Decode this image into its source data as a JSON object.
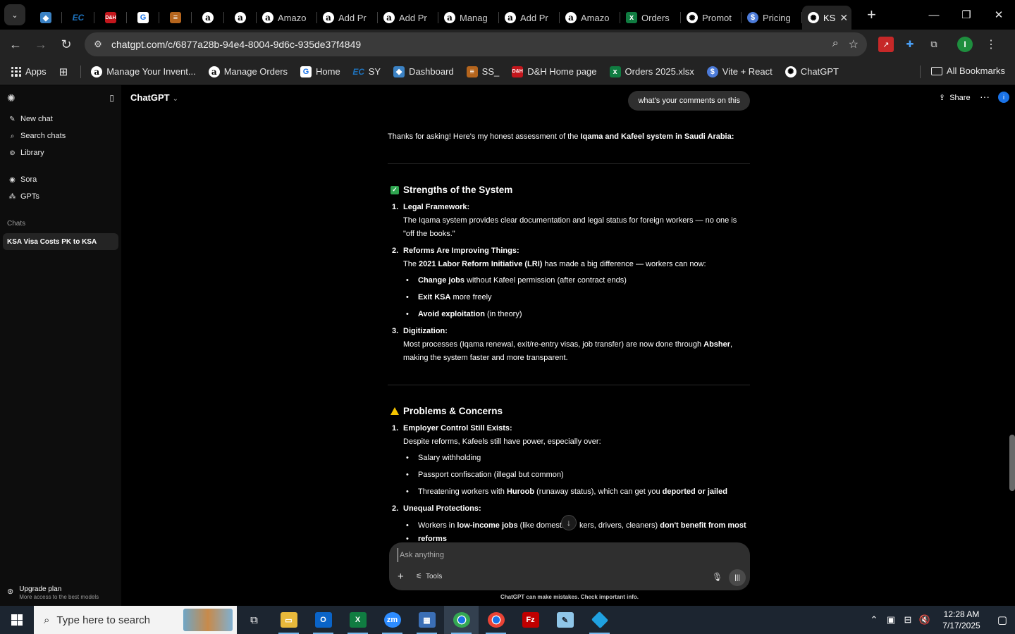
{
  "browser": {
    "tabs": [
      {
        "label": "",
        "icon": "blue-diamond-icon",
        "fav": "fv-blue",
        "glyph": "◆"
      },
      {
        "label": "",
        "icon": "ec-icon",
        "fav": "fv-ec",
        "glyph": "EC"
      },
      {
        "label": "",
        "icon": "dh-icon",
        "fav": "fv-dh",
        "glyph": "D&H"
      },
      {
        "label": "",
        "icon": "google-icon",
        "fav": "fv-g",
        "glyph": "G"
      },
      {
        "label": "",
        "icon": "stack-icon",
        "fav": "fv-stack",
        "glyph": "≡"
      },
      {
        "label": "",
        "icon": "amazon-icon",
        "fav": "fv-amz",
        "glyph": "a"
      },
      {
        "label": "",
        "icon": "amazon-icon",
        "fav": "fv-amz",
        "glyph": "a"
      },
      {
        "label": "Amazo",
        "icon": "amazon-icon",
        "fav": "fv-amz",
        "glyph": "a"
      },
      {
        "label": "Add Pr",
        "icon": "amazon-icon",
        "fav": "fv-amz",
        "glyph": "a"
      },
      {
        "label": "Add Pr",
        "icon": "amazon-icon",
        "fav": "fv-amz",
        "glyph": "a"
      },
      {
        "label": "Manag",
        "icon": "amazon-icon",
        "fav": "fv-amz",
        "glyph": "a"
      },
      {
        "label": "Add Pr",
        "icon": "amazon-icon",
        "fav": "fv-amz",
        "glyph": "a"
      },
      {
        "label": "Amazo",
        "icon": "amazon-icon",
        "fav": "fv-amz",
        "glyph": "a"
      },
      {
        "label": "Orders",
        "icon": "excel-icon",
        "fav": "fv-xl",
        "glyph": "x"
      },
      {
        "label": "Promot",
        "icon": "chatgpt-icon",
        "fav": "fv-gpt",
        "glyph": "✺"
      },
      {
        "label": "Pricing",
        "icon": "dollar-icon",
        "fav": "fv-s",
        "glyph": "$"
      }
    ],
    "active_tab": {
      "label": "KS",
      "icon": "chatgpt-icon"
    },
    "url": "chatgpt.com/c/6877a28b-94e4-8004-9d6c-935de37f4849",
    "bookmarks": [
      {
        "label": "Apps",
        "icon": "apps-grid-icon"
      },
      {
        "label": "Manage Your Invent...",
        "icon": "amazon-icon",
        "fav": "fv-amz",
        "glyph": "a"
      },
      {
        "label": "Manage Orders",
        "icon": "amazon-icon",
        "fav": "fv-amz",
        "glyph": "a"
      },
      {
        "label": "Home",
        "icon": "google-icon",
        "fav": "fv-g",
        "glyph": "G"
      },
      {
        "label": "SY",
        "icon": "ec-icon",
        "fav": "fv-ec",
        "glyph": "EC"
      },
      {
        "label": "Dashboard",
        "icon": "blue-diamond-icon",
        "fav": "fv-blue",
        "glyph": "◆"
      },
      {
        "label": "SS_",
        "icon": "stack-icon",
        "fav": "fv-stack",
        "glyph": "≡"
      },
      {
        "label": "D&H Home page",
        "icon": "dh-icon",
        "fav": "fv-dh",
        "glyph": "D&H"
      },
      {
        "label": "Orders 2025.xlsx",
        "icon": "excel-icon",
        "fav": "fv-xl",
        "glyph": "x"
      },
      {
        "label": "Vite + React",
        "icon": "dollar-icon",
        "fav": "fv-s",
        "glyph": "$"
      },
      {
        "label": "ChatGPT",
        "icon": "chatgpt-icon",
        "fav": "fv-gpt",
        "glyph": "✺"
      }
    ],
    "all_bookmarks": "All Bookmarks",
    "profile_initial": "I"
  },
  "sidebar": {
    "items": [
      {
        "label": "New chat",
        "icon": "✎",
        "name": "new-chat"
      },
      {
        "label": "Search chats",
        "icon": "⌕",
        "name": "search-chats"
      },
      {
        "label": "Library",
        "icon": "⊚",
        "name": "library"
      }
    ],
    "items2": [
      {
        "label": "Sora",
        "icon": "◉",
        "name": "sora"
      },
      {
        "label": "GPTs",
        "icon": "⁂",
        "name": "gpts"
      }
    ],
    "chats_heading": "Chats",
    "chats": [
      "KSA Visa Costs PK to KSA"
    ],
    "upgrade_title": "Upgrade plan",
    "upgrade_sub": "More access to the best models"
  },
  "header": {
    "model": "ChatGPT",
    "share": "Share",
    "account_initial": "i"
  },
  "conversation": {
    "user_message": "what's your comments on this",
    "intro_a": "Thanks for asking! Here's my honest assessment of the ",
    "intro_b": "Iqama and Kafeel system in Saudi Arabia:",
    "s1_title": "Strengths of the System",
    "s1_i1_head": "Legal Framework:",
    "s1_i1_text": "The Iqama system provides clear documentation and legal status for foreign workers — no one is \"off the books.\"",
    "s1_i2_head": "Reforms Are Improving Things:",
    "s1_i2_text_a": "The ",
    "s1_i2_text_b": "2021 Labor Reform Initiative (LRI)",
    "s1_i2_text_c": " has made a big difference — workers can now:",
    "s1_i2_b1_a": "Change jobs",
    "s1_i2_b1_b": " without Kafeel permission (after contract ends)",
    "s1_i2_b2_a": "Exit KSA",
    "s1_i2_b2_b": " more freely",
    "s1_i2_b3_a": "Avoid exploitation",
    "s1_i2_b3_b": " (in theory)",
    "s1_i3_head": "Digitization:",
    "s1_i3_text_a": "Most processes (Iqama renewal, exit/re-entry visas, job transfer) are now done through ",
    "s1_i3_text_b": "Absher",
    "s1_i3_text_c": ", making the system faster and more transparent.",
    "s2_title": "Problems & Concerns",
    "s2_i1_head": "Employer Control Still Exists:",
    "s2_i1_text": "Despite reforms, Kafeels still have power, especially over:",
    "s2_i1_b1": "Salary withholding",
    "s2_i1_b2": "Passport confiscation (illegal but common)",
    "s2_i1_b3_a": "Threatening workers with ",
    "s2_i1_b3_b": "Huroob",
    "s2_i1_b3_c": " (runaway status), which can get you ",
    "s2_i1_b3_d": "deported or jailed",
    "s2_i2_head": "Unequal Protections:",
    "s2_i2_b1_a": "Workers in ",
    "s2_i2_b1_b": "low-income jobs",
    "s2_i2_b1_c": " (like domestic ",
    "s2_i2_b1_d": "kers, drivers, cleaners) ",
    "s2_i2_b1_e": "don't benefit from most",
    "s2_i2_b1_f": "reforms"
  },
  "composer": {
    "placeholder": "Ask anything",
    "tools": "Tools",
    "disclaimer": "ChatGPT can make mistakes. Check important info."
  },
  "taskbar": {
    "search_placeholder": "Type here to search",
    "time": "12:28 AM",
    "date": "7/17/2025"
  }
}
